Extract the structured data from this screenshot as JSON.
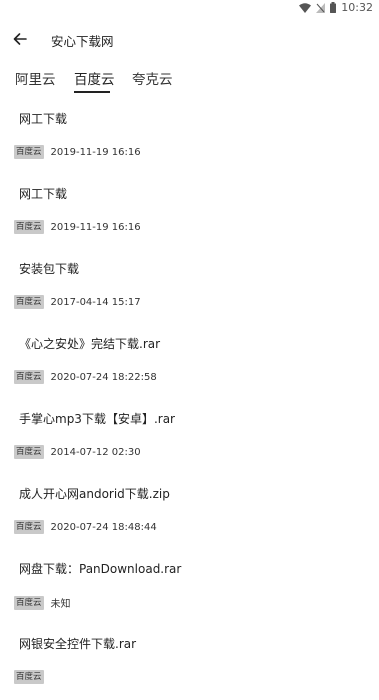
{
  "status_bar": {
    "time": "10:32"
  },
  "header": {
    "title": "安心下载网"
  },
  "tabs": [
    {
      "label": "阿里云"
    },
    {
      "label": "百度云"
    },
    {
      "label": "夸克云"
    }
  ],
  "active_tab_index": 1,
  "items": [
    {
      "title": "网工下载",
      "source": "百度云",
      "time": "2019-11-19 16:16"
    },
    {
      "title": "网工下载",
      "source": "百度云",
      "time": "2019-11-19 16:16"
    },
    {
      "title": "安装包下载",
      "source": "百度云",
      "time": "2017-04-14 15:17"
    },
    {
      "title": "《心之安处》完结下载.rar",
      "source": "百度云",
      "time": "2020-07-24 18:22:58"
    },
    {
      "title": "手掌心mp3下载【安卓】.rar",
      "source": "百度云",
      "time": "2014-07-12 02:30"
    },
    {
      "title": "成人开心网andorid下载.zip",
      "source": "百度云",
      "time": "2020-07-24 18:48:44"
    },
    {
      "title": "网盘下载：PanDownload.rar",
      "source": "百度云",
      "time": "未知"
    },
    {
      "title": "网银安全控件下载.rar",
      "source": "百度云",
      "time": ""
    }
  ]
}
